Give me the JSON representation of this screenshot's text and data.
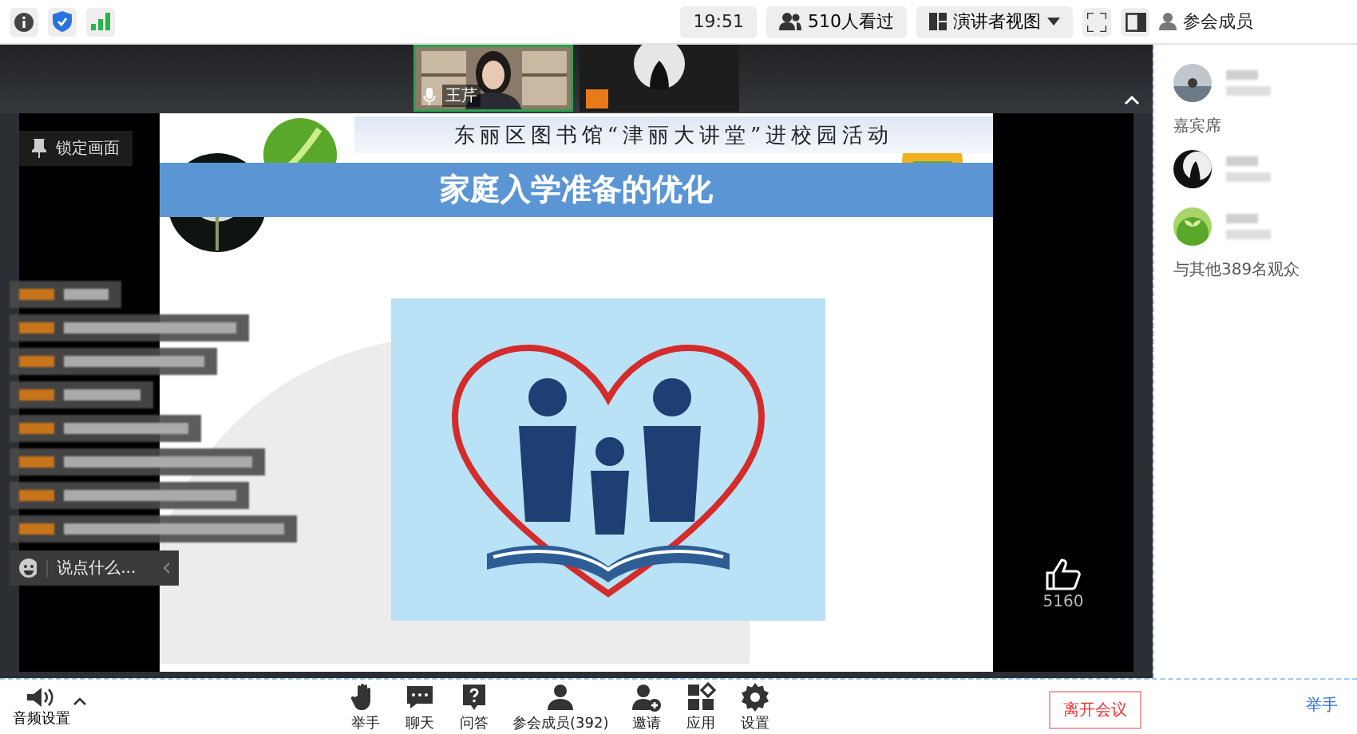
{
  "top_bar": {
    "time": "19:51",
    "viewers": "510人看过",
    "view_mode": "演讲者视图",
    "panel_title": "参会成员"
  },
  "video_tiles": [
    {
      "name": "王芹",
      "selected": true
    },
    {
      "selected": false
    }
  ],
  "slide": {
    "subtitle": "东丽区图书馆“津丽大讲堂”进校园活动",
    "title": "家庭入学准备的优化"
  },
  "chat": {
    "lock_label": "锁定画面",
    "placeholder": "说点什么..."
  },
  "likes": "5160",
  "toolbar": {
    "audio_label": "音频设置",
    "buttons": [
      {
        "kind": "hand",
        "label": "举手"
      },
      {
        "kind": "chat",
        "label": "聊天"
      },
      {
        "kind": "qa",
        "label": "问答"
      },
      {
        "kind": "members",
        "label": "参会成员(392)"
      },
      {
        "kind": "invite",
        "label": "邀请"
      },
      {
        "kind": "apps",
        "label": "应用"
      },
      {
        "kind": "settings",
        "label": "设置"
      }
    ],
    "leave_label": "离开会议"
  },
  "members_panel": {
    "section": "嘉宾席",
    "others": "与其他389名观众",
    "raise_hand": "举手"
  }
}
